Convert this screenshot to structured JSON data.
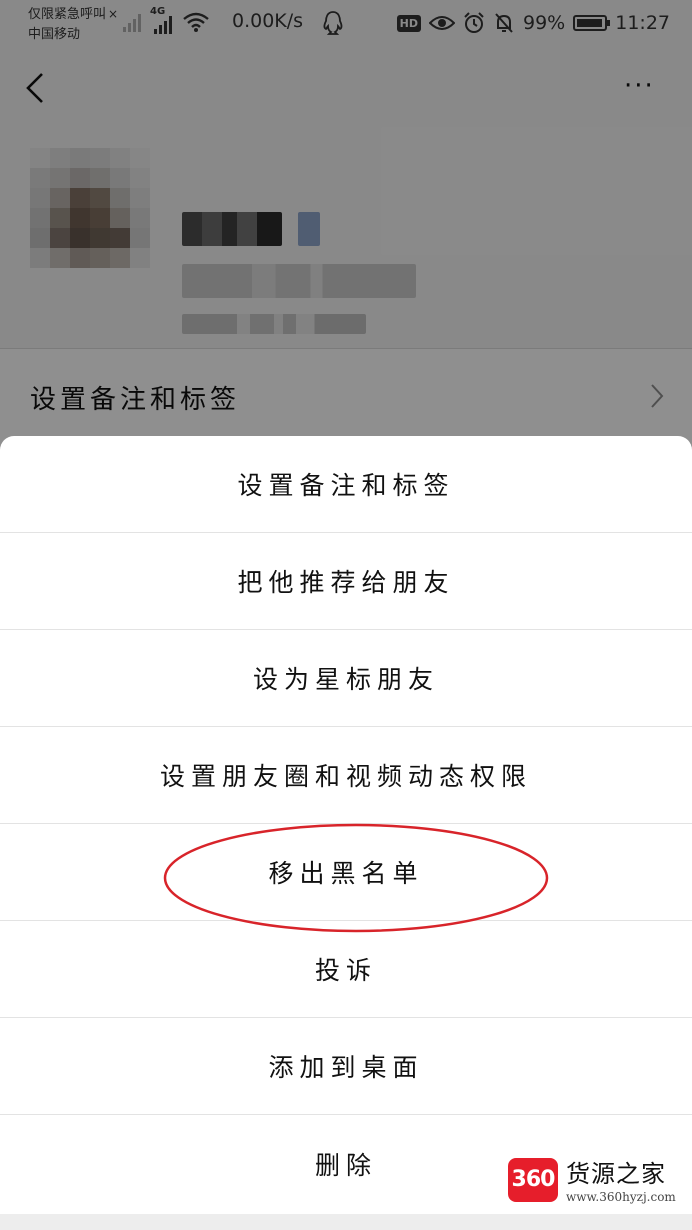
{
  "status_bar": {
    "carrier_line1": "仅限紧急呼叫",
    "carrier_x": "×",
    "carrier_line2": "中国移动",
    "network_type": "4G",
    "net_speed": "0.00K/s",
    "hd_label": "HD",
    "battery_percent": "99%",
    "time": "11:27",
    "battery_level": 0.99
  },
  "nav": {
    "back_icon": "chevron-left-icon",
    "more_icon": "more-dots-icon",
    "more_label": "···"
  },
  "profile": {
    "remark_label": "设置备注和标签"
  },
  "sheet": {
    "items": [
      {
        "label": "设置备注和标签"
      },
      {
        "label": "把他推荐给朋友"
      },
      {
        "label": "设为星标朋友"
      },
      {
        "label": "设置朋友圈和视频动态权限"
      },
      {
        "label": "移出黑名单"
      },
      {
        "label": "投诉"
      },
      {
        "label": "添加到桌面"
      },
      {
        "label": "删除"
      }
    ]
  },
  "annotation": {
    "color": "#d8242a"
  },
  "watermark": {
    "logo_text": "360",
    "title": "货源之家",
    "url": "www.360hyzj.com"
  }
}
